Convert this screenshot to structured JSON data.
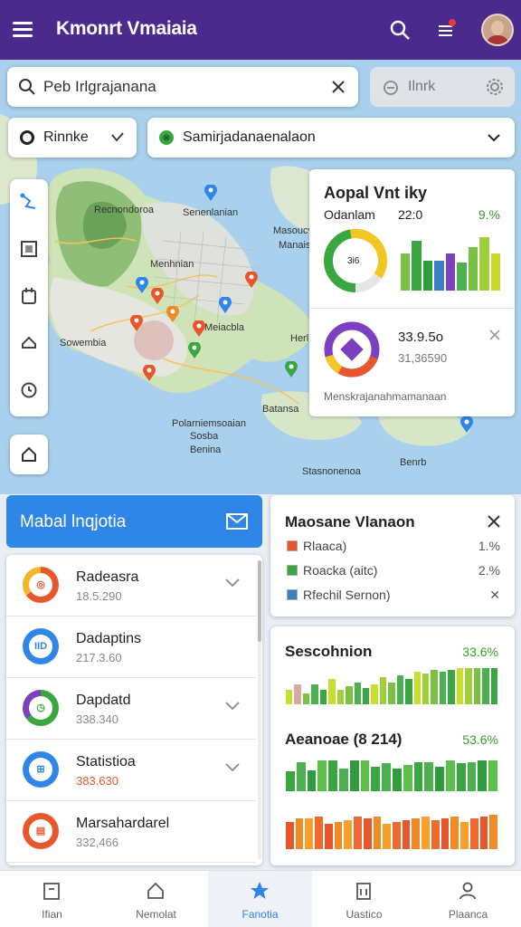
{
  "app": {
    "title": "Kmonrt Vmaiaia"
  },
  "search": {
    "value": "Peb Irlgrajanana",
    "link_label": "Ilnrk"
  },
  "filters": {
    "chip1": "Rinnke",
    "chip2": "Samirjadanaenalaon"
  },
  "map_labels": [
    {
      "text": "Recnondoroa"
    },
    {
      "text": "Senenlanian"
    },
    {
      "text": "Menhnian"
    },
    {
      "text": "Masoucvrtelisa"
    },
    {
      "text": "Manaisaia"
    },
    {
      "text": "Sowembia"
    },
    {
      "text": "Meiacbla"
    },
    {
      "text": "Herl"
    },
    {
      "text": "Batansa"
    },
    {
      "text": "Polarniemsoaian"
    },
    {
      "text": "Sosba"
    },
    {
      "text": "Benina"
    },
    {
      "text": "Stasnonenoa"
    },
    {
      "text": "Benrb"
    }
  ],
  "stats_card": {
    "title": "Aopal Vnt iky",
    "subtitle": "Odanlam",
    "value": "22:0",
    "pct": "9.%",
    "donut_text": "3i6",
    "metric1": "33.9.5o",
    "metric2": "31,36590",
    "footer": "Menskrajanahmamanaan",
    "bars": [
      0.55,
      0.75,
      0.45,
      0.45,
      0.55,
      0.42,
      0.65,
      0.8,
      0.55
    ],
    "bar_colors": [
      "#7ac142",
      "#3aa642",
      "#2f9d3e",
      "#3b7fc4",
      "#7b3fbf",
      "#4caf50",
      "#76c043",
      "#9dcf3a",
      "#c9d62a"
    ]
  },
  "section": {
    "title": "Mabal lnqjotia"
  },
  "list_items": [
    {
      "name": "Radeasra",
      "value": "18.5.290",
      "ring": "#e8562c",
      "ring2": "#f3b52b",
      "glyph": "◎",
      "chev": true
    },
    {
      "name": "Dadaptins",
      "value": "217.3.60",
      "ring": "#2f86e6",
      "ring2": "#2f86e6",
      "glyph": "IID",
      "chev": false
    },
    {
      "name": "Dapdatd",
      "value": "338.340",
      "ring": "#3aa642",
      "ring2": "#7b3fbf",
      "glyph": "◷",
      "chev": true
    },
    {
      "name": "Statistioa",
      "value": "383.630",
      "ring": "#2f86e6",
      "ring2": "#2f86e6",
      "glyph": "⊞",
      "chev": true
    },
    {
      "name": "Marsahardarel",
      "value": "332,466",
      "ring": "#e8562c",
      "ring2": "#e8562c",
      "glyph": "▤",
      "chev": false
    }
  ],
  "measure_card": {
    "title": "Maosane Vlanaon",
    "rows": [
      {
        "label": "Rlaaca)",
        "pct": "1.%",
        "color": "#e8562c"
      },
      {
        "label": "Roacka (aitc)",
        "pct": "2.%",
        "color": "#3aa642"
      },
      {
        "label": "Rfechil Sernon)",
        "pct": "✕",
        "color": "#3b7fc4"
      }
    ]
  },
  "bar_panels": [
    {
      "label": "Sescohnion",
      "pct": "33.6%",
      "colors": "lime",
      "values": [
        0.4,
        0.55,
        0.3,
        0.55,
        0.4,
        0.7,
        0.4,
        0.5,
        0.6,
        0.45,
        0.55,
        0.75,
        0.6,
        0.8,
        0.7,
        0.9,
        0.85,
        0.95,
        0.9,
        0.95,
        1,
        1,
        1,
        1,
        1
      ]
    },
    {
      "label": "Aeanoae (8 214)",
      "pct": "53.6%",
      "colors": "green",
      "values": [
        0.6,
        0.9,
        0.65,
        0.95,
        0.95,
        0.7,
        0.95,
        0.95,
        0.75,
        0.85,
        0.7,
        0.8,
        0.9,
        0.9,
        0.75,
        0.95,
        0.85,
        0.9,
        0.95,
        0.95
      ]
    },
    {
      "label": "",
      "pct": "",
      "colors": "orange",
      "values": [
        0.75,
        0.85,
        0.85,
        0.9,
        0.7,
        0.75,
        0.8,
        0.9,
        0.85,
        0.9,
        0.7,
        0.75,
        0.8,
        0.85,
        0.9,
        0.8,
        0.85,
        0.9,
        0.75,
        0.85,
        0.9,
        0.95
      ]
    }
  ],
  "nav": [
    {
      "label": "Ifian",
      "icon": "home-icon"
    },
    {
      "label": "Nemolat",
      "icon": "house-outline-icon"
    },
    {
      "label": "Fanotia",
      "icon": "star-icon",
      "active": true
    },
    {
      "label": "Uastico",
      "icon": "clipboard-icon"
    },
    {
      "label": "Plaanca",
      "icon": "person-icon"
    }
  ]
}
